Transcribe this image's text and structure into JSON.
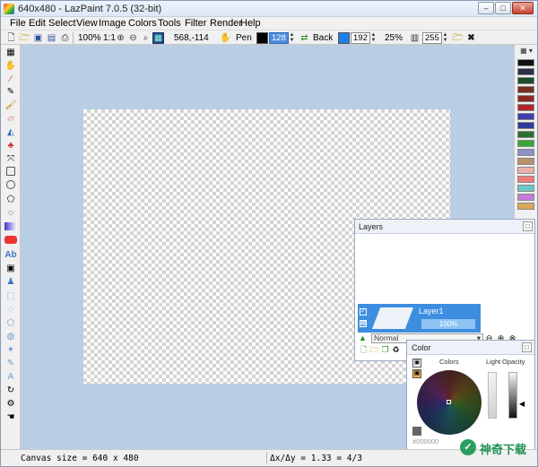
{
  "window": {
    "title": "640x480 - LazPaint 7.0.5 (32-bit)"
  },
  "menu": [
    "File",
    "Edit",
    "Select",
    "View",
    "Image",
    "Colors",
    "Tools",
    "Filter",
    "Render",
    "Help"
  ],
  "toolbar": {
    "zoom": "100%",
    "zoom_ratio": "1:1",
    "coords": "568,-114",
    "pen_label": "Pen",
    "pen_color": "#000000",
    "pen_alpha": "128",
    "back_label": "Back",
    "back_color": "#1f7fe8",
    "back_alpha": "192",
    "tolerance": "25%",
    "opacity": "255"
  },
  "palette_colors": [
    "#111111",
    "#2a3046",
    "#1d4c2a",
    "#7a2c1e",
    "#8a2a1f",
    "#b5262a",
    "#3f3fb2",
    "#2e3b99",
    "#2d6e2f",
    "#3aa53a",
    "#8d91c9",
    "#bd8f6a",
    "#e7b3a8",
    "#f37a7a",
    "#6bc8c8",
    "#c77bd8",
    "#d7a75a"
  ],
  "layers": {
    "title": "Layers",
    "layer_name": "Layer1",
    "layer_opacity": "100%",
    "blend_mode": "Normal"
  },
  "color_panel": {
    "title": "Color",
    "colors_label": "Colors",
    "light_label": "Light",
    "opacity_label": "Opacity",
    "hex_value": "#000000"
  },
  "status": {
    "canvas_size": "Canvas size = 640 x 480",
    "ratio": "Δx/Δy = 1.33 = 4/3"
  },
  "watermark": {
    "text": "神奇下载"
  }
}
